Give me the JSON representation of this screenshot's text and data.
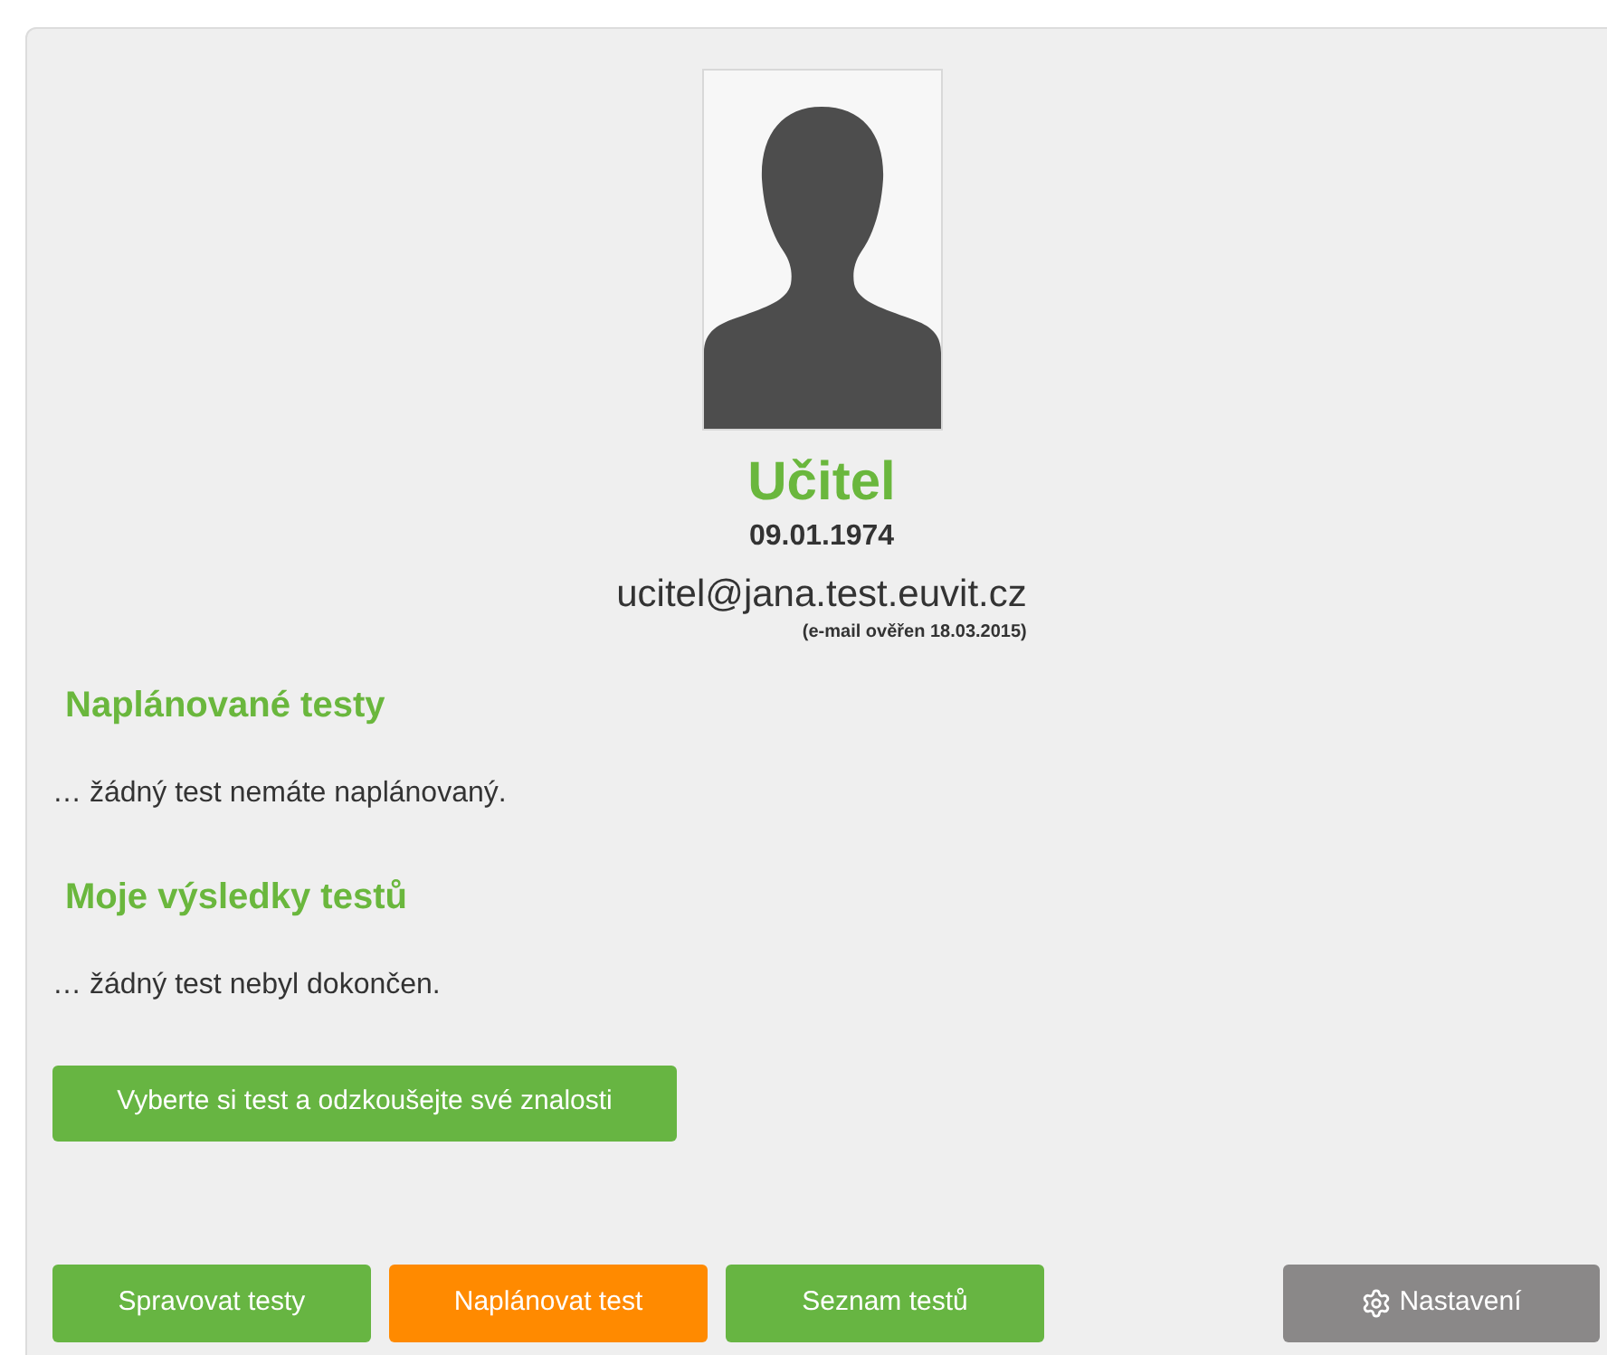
{
  "profile": {
    "name": "Učitel",
    "birth_date": "09.01.1974",
    "email": "ucitel@jana.test.euvit.cz",
    "email_note": "(e-mail ověřen 18.03.2015)"
  },
  "sections": [
    {
      "title": "Naplánované testy",
      "text": "… žádný test nemáte naplánovaný."
    },
    {
      "title": "Moje výsledky testů",
      "text": "… žádný test nebyl dokončen."
    }
  ],
  "cta_button": "Vyberte si test a odzkoušejte své znalosti",
  "bottom_buttons": [
    {
      "label": "Spravovat testy",
      "kind": "primary"
    },
    {
      "label": "Naplánovat test",
      "kind": "warning"
    },
    {
      "label": "Seznam testů",
      "kind": "primary"
    },
    {
      "label": "Nastavení",
      "kind": "settings"
    }
  ]
}
